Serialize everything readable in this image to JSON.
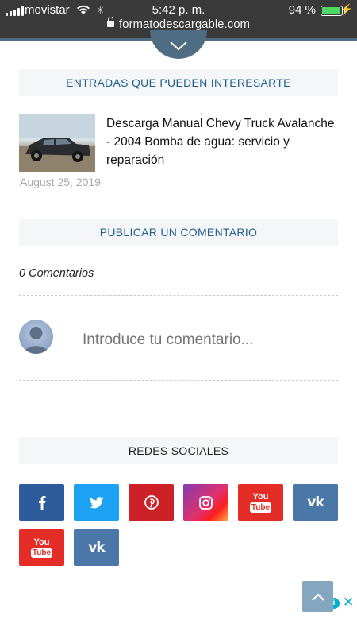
{
  "status_bar": {
    "carrier": "movistar",
    "time": "5:42 p. m.",
    "battery_percent": "94 %",
    "battery_level": 0.94
  },
  "browser": {
    "url": "formatodescargable.com"
  },
  "related": {
    "heading": "ENTRADAS QUE PUEDEN INTERESARTE",
    "post": {
      "title": "Descarga Manual Chevy Truck Avalanche - 2004 Bomba de agua: servicio y reparación",
      "date": "August 25, 2019"
    }
  },
  "comments": {
    "heading": "PUBLICAR UN COMENTARIO",
    "count_label": "0 Comentarios",
    "input_placeholder": "Introduce tu comentario..."
  },
  "social": {
    "heading": "REDES SOCIALES",
    "icons": [
      "facebook-icon",
      "twitter-icon",
      "pinterest-icon",
      "instagram-icon",
      "youtube-icon",
      "vk-icon",
      "youtube-icon",
      "vk-icon"
    ],
    "youtube_text_top": "You",
    "youtube_text_bottom": "Tube",
    "vk_text": "vk"
  },
  "ad": {
    "info_glyph": "i",
    "close_glyph": "✕"
  },
  "colors": {
    "accent": "#1f5f8b",
    "header_bar": "#4f6d82",
    "back_to_top": "#84a6bf"
  }
}
